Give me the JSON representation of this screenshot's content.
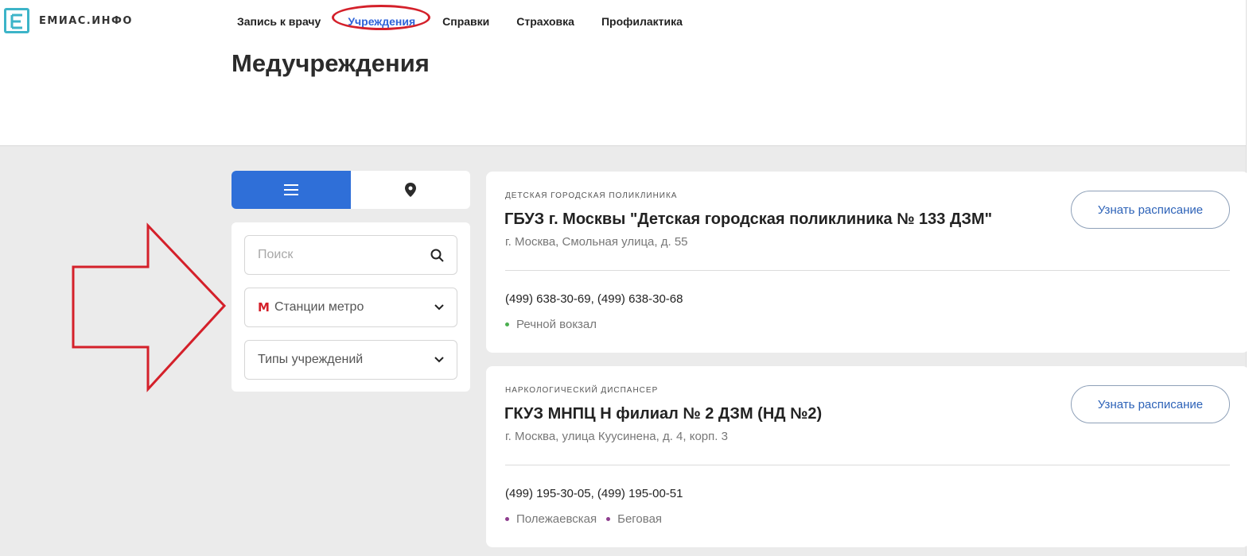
{
  "brand": {
    "name": "ЕМИАС.ИНФО",
    "accent": "#3cb4c8",
    "icon": "logo-e-icon"
  },
  "nav": {
    "items": [
      {
        "label": "Запись к врачу",
        "active": false
      },
      {
        "label": "Учреждения",
        "active": true
      },
      {
        "label": "Справки",
        "active": false
      },
      {
        "label": "Страховка",
        "active": false
      },
      {
        "label": "Профилактика",
        "active": false
      }
    ]
  },
  "page": {
    "title": "Медучреждения"
  },
  "view_toggle": {
    "list_icon": "list-icon",
    "map_icon": "map-pin-icon",
    "selected": "list",
    "active_color": "#2f6fd8"
  },
  "filters": {
    "search": {
      "placeholder": "Поиск",
      "value": "",
      "icon": "search-icon"
    },
    "metro": {
      "label": "Станции метро",
      "icon": "metro-icon"
    },
    "types": {
      "label": "Типы учреждений"
    }
  },
  "institutions": [
    {
      "type": "детская городская поликлиника",
      "name": "ГБУЗ г. Москвы \"Детская городская поликлиника № 133 ДЗМ\"",
      "address": "г. Москва, Смольная улица, д. 55",
      "phones": "(499) 638-30-69,  (499) 638-30-68",
      "metro": [
        {
          "name": "Речной вокзал",
          "color": "#4caf50"
        }
      ],
      "button": "Узнать расписание"
    },
    {
      "type": "наркологический диспансер",
      "name": "ГКУЗ МНПЦ Н филиал № 2 ДЗМ (НД №2)",
      "address": "г. Москва, улица Куусинена, д. 4, корп. 3",
      "phones": "(499) 195-30-05,  (499) 195-00-51",
      "metro": [
        {
          "name": "Полежаевская",
          "color": "#8e3d8e"
        },
        {
          "name": "Беговая",
          "color": "#8e3d8e"
        }
      ],
      "button": "Узнать расписание"
    }
  ],
  "annotations": {
    "highlight_color": "#d4202a"
  }
}
